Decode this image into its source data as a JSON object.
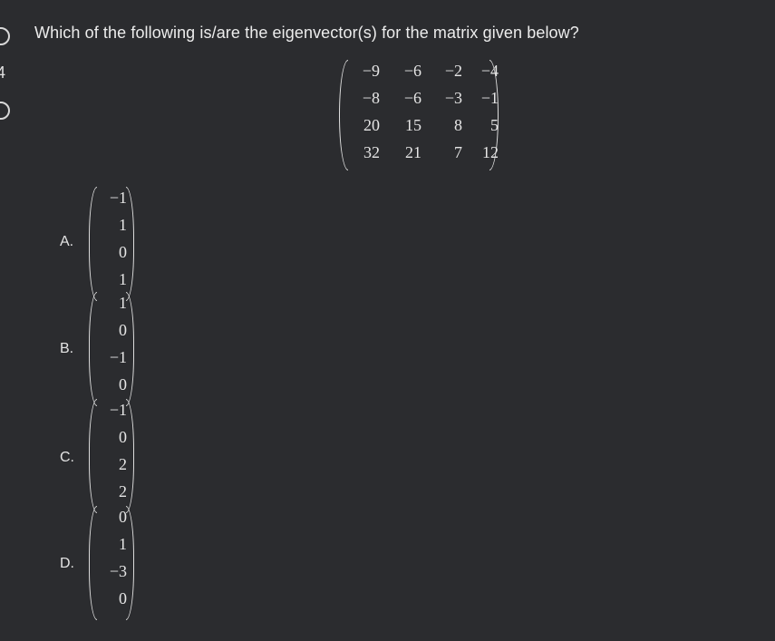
{
  "edge": {
    "number": "4"
  },
  "question": {
    "text": "Which of the following is/are the eigenvector(s) for the matrix given below?"
  },
  "matrix": {
    "rows": [
      [
        "−9",
        "−6",
        "−2",
        "−4"
      ],
      [
        "−8",
        "−6",
        "−3",
        "−1"
      ],
      [
        "20",
        "15",
        "8",
        "5"
      ],
      [
        "32",
        "21",
        "7",
        "12"
      ]
    ]
  },
  "options": [
    {
      "label": "A.",
      "vector": [
        "−1",
        "1",
        "0",
        "1"
      ]
    },
    {
      "label": "B.",
      "vector": [
        "1",
        "0",
        "−1",
        "0"
      ]
    },
    {
      "label": "C.",
      "vector": [
        "−1",
        "0",
        "2",
        "2"
      ]
    },
    {
      "label": "D.",
      "vector": [
        "0",
        "1",
        "−3",
        "0"
      ]
    }
  ]
}
